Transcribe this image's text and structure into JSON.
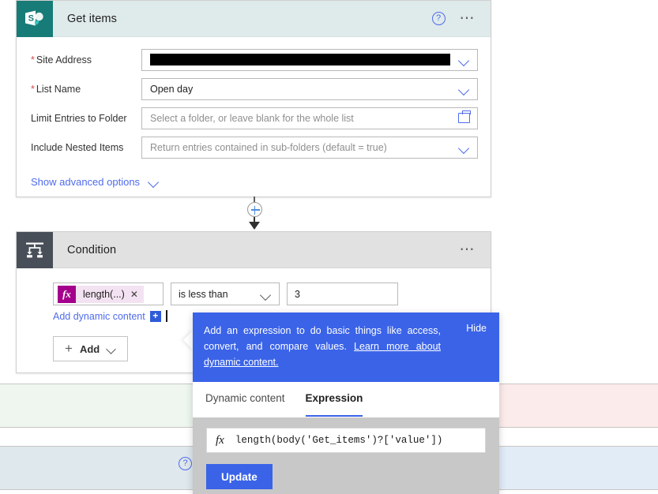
{
  "get_items_card": {
    "icon": "sharepoint-icon",
    "title": "Get items",
    "help_icon": "help-circle-icon",
    "menu_icon": "ellipsis-icon",
    "fields": [
      {
        "label": "Site Address",
        "required": true,
        "value": "",
        "redacted": true,
        "control": "dropdown",
        "icon": "chevron-down-icon"
      },
      {
        "label": "List Name",
        "required": true,
        "value": "Open day",
        "redacted": false,
        "control": "dropdown",
        "icon": "chevron-down-icon"
      },
      {
        "label": "Limit Entries to Folder",
        "required": false,
        "placeholder": "Select a folder, or leave blank for the whole list",
        "control": "folder-picker",
        "icon": "folder-icon"
      },
      {
        "label": "Include Nested Items",
        "required": false,
        "placeholder": "Return entries contained in sub-folders (default = true)",
        "control": "dropdown",
        "icon": "chevron-down-icon"
      }
    ],
    "advanced_options_label": "Show advanced options",
    "advanced_options_icon": "chevron-down-icon"
  },
  "connector": {
    "add_icon": "plus-circle-icon",
    "arrow_icon": "arrow-down-icon"
  },
  "condition_card": {
    "icon": "condition-branch-icon",
    "title": "Condition",
    "menu_icon": "ellipsis-icon",
    "row": {
      "left_token": {
        "fx_badge": "fx",
        "label": "length(...)",
        "remove_icon": "close-icon"
      },
      "operator": "is less than",
      "operator_icon": "chevron-down-icon",
      "value": "3"
    },
    "dynamic_content_link": "Add dynamic content",
    "dynamic_content_badge": "+",
    "add_button": {
      "plus_icon": "plus-icon",
      "label": "Add",
      "chevron_icon": "chevron-down-icon"
    }
  },
  "flyout": {
    "tip": {
      "text_before_link": "Add an expression to do basic things like access, convert, and compare values. ",
      "link_text": "Learn more about dynamic content.",
      "hide_label": "Hide",
      "background_color": "#3a63e8"
    },
    "tabs": [
      {
        "label": "Dynamic content",
        "active": false
      },
      {
        "label": "Expression",
        "active": true
      }
    ],
    "expression_input": {
      "fx_prefix": "fx",
      "value": "length(body('Get_items')?['value'])"
    },
    "update_button": "Update",
    "accent_color": "#3a63e8"
  },
  "branches": {
    "help_icon": "help-circle-icon",
    "yes_lane_color": "#eef6ef",
    "no_lane_color": "#fcebeb",
    "lower_left_lane_color": "#dfe8ec",
    "lower_right_lane_color": "#e2ecf7"
  }
}
